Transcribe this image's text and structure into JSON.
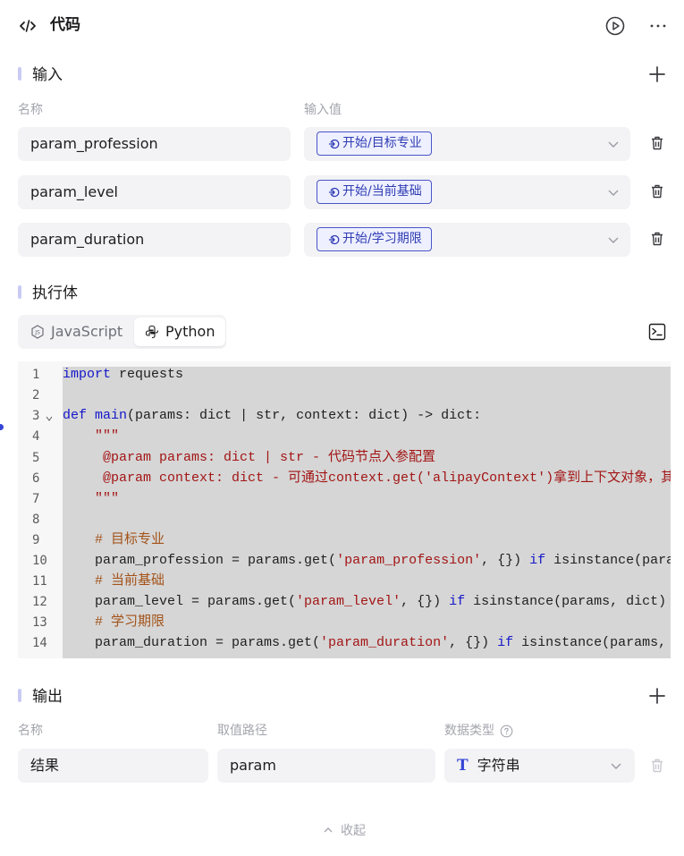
{
  "header": {
    "title": "代码"
  },
  "input": {
    "title": "输入",
    "col_name": "名称",
    "col_value": "输入值",
    "rows": [
      {
        "name": "param_profession",
        "ref": "开始/目标专业"
      },
      {
        "name": "param_level",
        "ref": "开始/当前基础"
      },
      {
        "name": "param_duration",
        "ref": "开始/学习期限"
      }
    ]
  },
  "body_section": {
    "title": "执行体",
    "tabs": [
      {
        "label": "JavaScript",
        "active": false
      },
      {
        "label": "Python",
        "active": true
      }
    ]
  },
  "editor": {
    "line_numbers": [
      "1",
      "2",
      "3",
      "4",
      "5",
      "6",
      "7",
      "8",
      "9",
      "10",
      "11",
      "12",
      "13",
      "14"
    ],
    "lines": [
      "import requests",
      "",
      "def main(params: dict | str, context: dict) -> dict:",
      "    \"\"\"",
      "     @param params: dict | str - 代码节点入参配置",
      "     @param context: dict - 可通过context.get('alipayContext')拿到上下文对象，其中",
      "    \"\"\"",
      "",
      "    # 目标专业",
      "    param_profession = params.get('param_profession', {}) if isinstance(params, di",
      "    # 当前基础",
      "    param_level = params.get('param_level', {}) if isinstance(params, dict) else p",
      "    # 学习期限",
      "    param_duration = params.get('param_duration', {}) if isinstance(params, dict)"
    ]
  },
  "output": {
    "title": "输出",
    "col_name": "名称",
    "col_path": "取值路径",
    "col_type": "数据类型",
    "rows": [
      {
        "name": "结果",
        "path": "param",
        "type_icon": "T",
        "type": "字符串"
      }
    ]
  },
  "footer": {
    "collapse_label": "收起"
  },
  "colors": {
    "accent": "#3645d6",
    "tag_border": "#4a55c9",
    "section_bar": "#c9cbf5"
  }
}
